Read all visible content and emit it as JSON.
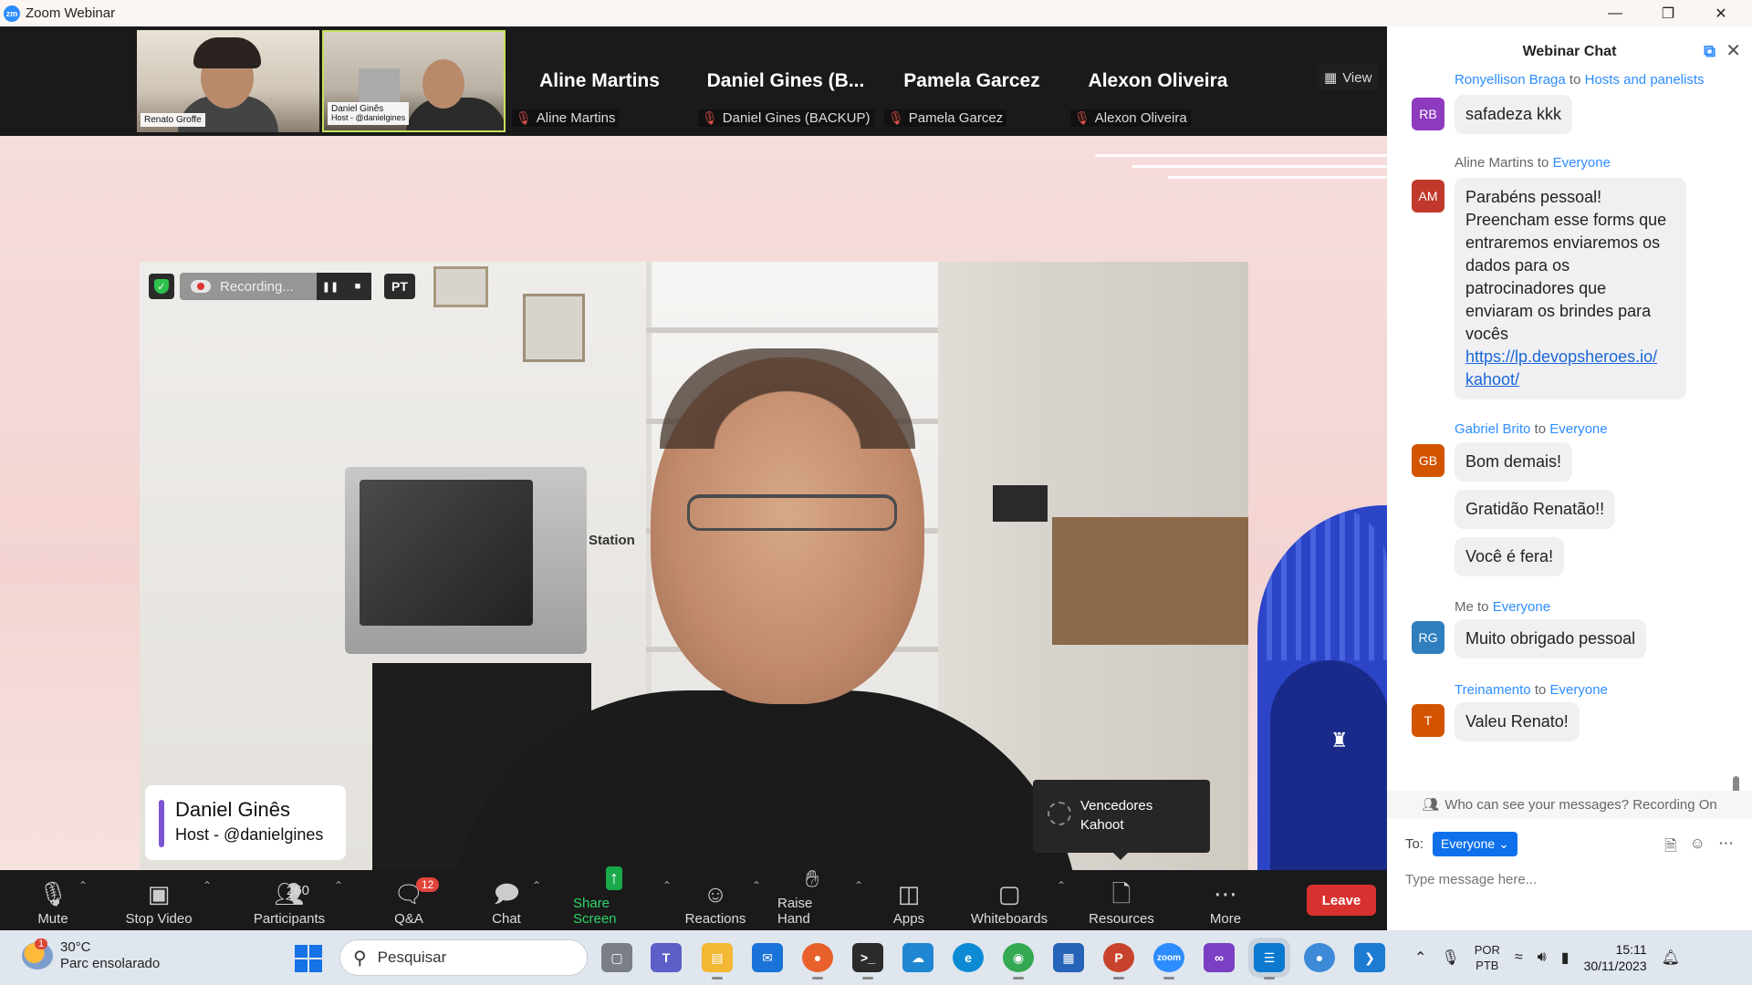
{
  "titlebar": {
    "logo": "zm",
    "title": "Zoom Webinar",
    "controls": [
      "minimize-icon",
      "restore-icon",
      "close-icon"
    ]
  },
  "participants_strip": {
    "videos": [
      {
        "caption_name": "Renato Groffe",
        "caption_role": ""
      },
      {
        "caption_name": "Daniel Ginês",
        "caption_role": "Host - @danielgines"
      }
    ],
    "tiles": [
      {
        "display": "Aline Martins",
        "label": "Aline Martins"
      },
      {
        "display": "Daniel Gines (B...",
        "label": "Daniel Gines (BACKUP)"
      },
      {
        "display": "Pamela Garcez",
        "label": "Pamela Garcez"
      },
      {
        "display": "Alexon Oliveira",
        "label": "Alexon Oliveira"
      }
    ],
    "view_label": "View"
  },
  "stage": {
    "recording_label": "Recording...",
    "language_badge": "PT",
    "tv_brand_text": "Station",
    "name_card": {
      "name": "Daniel Ginês",
      "subtitle": "Host - @danielgines"
    },
    "tooltip": {
      "line1": "Vencedores",
      "line2": "Kahoot"
    }
  },
  "toolbar": {
    "mute": "Mute",
    "stop_video": "Stop Video",
    "participants": "Participants",
    "participants_count": "260",
    "qa": "Q&A",
    "qa_badge": "12",
    "chat": "Chat",
    "share_screen": "Share Screen",
    "reactions": "Reactions",
    "raise_hand": "Raise Hand",
    "apps": "Apps",
    "whiteboards": "Whiteboards",
    "resources": "Resources",
    "more": "More",
    "leave": "Leave"
  },
  "chat": {
    "title": "Webinar Chat",
    "messages": [
      {
        "sender": "Ronyellison Braga",
        "to_word": "to",
        "target": "Hosts and panelists",
        "initials": "RB",
        "color": "#8e3bbf",
        "texts": [
          "safadeza kkk"
        ]
      },
      {
        "sender": "Aline Martins",
        "to_word": "to",
        "target": "Everyone",
        "initials": "AM",
        "color": "#c0392b",
        "texts": [
          "Parabéns pessoal! Preencham esse forms que entraremos enviaremos os dados para os patrocinadores que enviaram os brindes para vocês"
        ],
        "link": "https://lp.devopsheroes.io/kahoot/",
        "link_line1": "https://lp.devopsheroes.io/",
        "link_line2": "kahoot/"
      },
      {
        "sender": "Gabriel Brito",
        "to_word": "to",
        "target": "Everyone",
        "initials": "GB",
        "color": "#d35400",
        "texts": [
          "Bom demais!",
          "Gratidão Renatão!!",
          "Você é fera!"
        ]
      },
      {
        "sender": "Me",
        "to_word": "to",
        "target": "Everyone",
        "initials": "RG",
        "color": "#2f7fbf",
        "texts": [
          "Muito obrigado pessoal"
        ]
      },
      {
        "sender": "Treinamento",
        "to_word": "to",
        "target": "Everyone",
        "initials": "T",
        "color": "#d35400",
        "texts": [
          "Valeu Renato!"
        ]
      }
    ],
    "notice": "Who can see your messages? Recording On",
    "to_label": "To:",
    "to_value": "Everyone",
    "input_placeholder": "Type message here..."
  },
  "taskbar": {
    "weather": {
      "badge": "1",
      "temp": "30°C",
      "desc": "Parc ensolarado"
    },
    "search_placeholder": "Pesquisar",
    "apps": [
      "file-explorer-icon",
      "teams-icon",
      "folder-icon",
      "mail-icon",
      "firefox-icon",
      "terminal-icon",
      "azure-icon",
      "edge-icon",
      "chrome-icon",
      "app-grid-icon",
      "powerpoint-icon",
      "zoom-icon",
      "visual-studio-icon",
      "notepad-icon",
      "globe-icon",
      "vscode-icon"
    ],
    "lang_line1": "POR",
    "lang_line2": "PTB",
    "time": "15:11",
    "date": "30/11/2023"
  }
}
